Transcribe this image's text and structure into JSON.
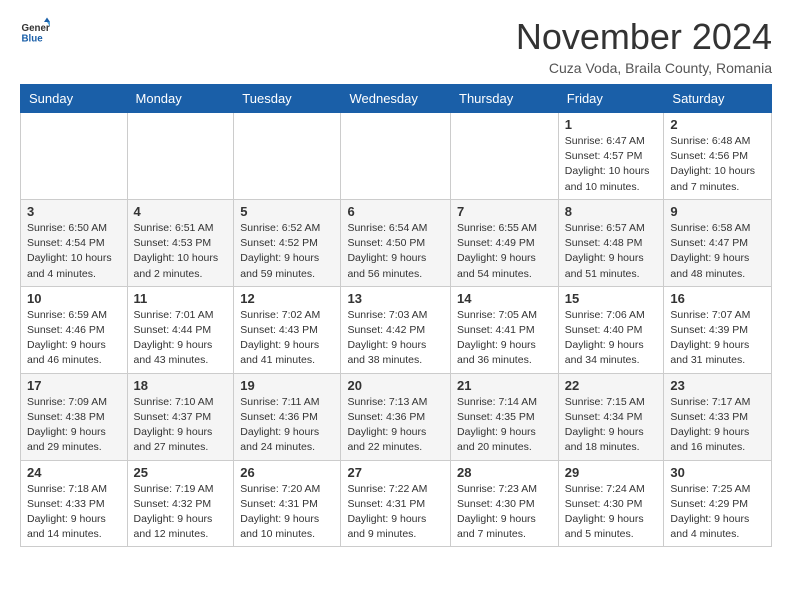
{
  "header": {
    "logo_line1": "General",
    "logo_line2": "Blue",
    "month_title": "November 2024",
    "location": "Cuza Voda, Braila County, Romania"
  },
  "weekdays": [
    "Sunday",
    "Monday",
    "Tuesday",
    "Wednesday",
    "Thursday",
    "Friday",
    "Saturday"
  ],
  "weeks": [
    [
      {
        "day": "",
        "info": ""
      },
      {
        "day": "",
        "info": ""
      },
      {
        "day": "",
        "info": ""
      },
      {
        "day": "",
        "info": ""
      },
      {
        "day": "",
        "info": ""
      },
      {
        "day": "1",
        "info": "Sunrise: 6:47 AM\nSunset: 4:57 PM\nDaylight: 10 hours and 10 minutes."
      },
      {
        "day": "2",
        "info": "Sunrise: 6:48 AM\nSunset: 4:56 PM\nDaylight: 10 hours and 7 minutes."
      }
    ],
    [
      {
        "day": "3",
        "info": "Sunrise: 6:50 AM\nSunset: 4:54 PM\nDaylight: 10 hours and 4 minutes."
      },
      {
        "day": "4",
        "info": "Sunrise: 6:51 AM\nSunset: 4:53 PM\nDaylight: 10 hours and 2 minutes."
      },
      {
        "day": "5",
        "info": "Sunrise: 6:52 AM\nSunset: 4:52 PM\nDaylight: 9 hours and 59 minutes."
      },
      {
        "day": "6",
        "info": "Sunrise: 6:54 AM\nSunset: 4:50 PM\nDaylight: 9 hours and 56 minutes."
      },
      {
        "day": "7",
        "info": "Sunrise: 6:55 AM\nSunset: 4:49 PM\nDaylight: 9 hours and 54 minutes."
      },
      {
        "day": "8",
        "info": "Sunrise: 6:57 AM\nSunset: 4:48 PM\nDaylight: 9 hours and 51 minutes."
      },
      {
        "day": "9",
        "info": "Sunrise: 6:58 AM\nSunset: 4:47 PM\nDaylight: 9 hours and 48 minutes."
      }
    ],
    [
      {
        "day": "10",
        "info": "Sunrise: 6:59 AM\nSunset: 4:46 PM\nDaylight: 9 hours and 46 minutes."
      },
      {
        "day": "11",
        "info": "Sunrise: 7:01 AM\nSunset: 4:44 PM\nDaylight: 9 hours and 43 minutes."
      },
      {
        "day": "12",
        "info": "Sunrise: 7:02 AM\nSunset: 4:43 PM\nDaylight: 9 hours and 41 minutes."
      },
      {
        "day": "13",
        "info": "Sunrise: 7:03 AM\nSunset: 4:42 PM\nDaylight: 9 hours and 38 minutes."
      },
      {
        "day": "14",
        "info": "Sunrise: 7:05 AM\nSunset: 4:41 PM\nDaylight: 9 hours and 36 minutes."
      },
      {
        "day": "15",
        "info": "Sunrise: 7:06 AM\nSunset: 4:40 PM\nDaylight: 9 hours and 34 minutes."
      },
      {
        "day": "16",
        "info": "Sunrise: 7:07 AM\nSunset: 4:39 PM\nDaylight: 9 hours and 31 minutes."
      }
    ],
    [
      {
        "day": "17",
        "info": "Sunrise: 7:09 AM\nSunset: 4:38 PM\nDaylight: 9 hours and 29 minutes."
      },
      {
        "day": "18",
        "info": "Sunrise: 7:10 AM\nSunset: 4:37 PM\nDaylight: 9 hours and 27 minutes."
      },
      {
        "day": "19",
        "info": "Sunrise: 7:11 AM\nSunset: 4:36 PM\nDaylight: 9 hours and 24 minutes."
      },
      {
        "day": "20",
        "info": "Sunrise: 7:13 AM\nSunset: 4:36 PM\nDaylight: 9 hours and 22 minutes."
      },
      {
        "day": "21",
        "info": "Sunrise: 7:14 AM\nSunset: 4:35 PM\nDaylight: 9 hours and 20 minutes."
      },
      {
        "day": "22",
        "info": "Sunrise: 7:15 AM\nSunset: 4:34 PM\nDaylight: 9 hours and 18 minutes."
      },
      {
        "day": "23",
        "info": "Sunrise: 7:17 AM\nSunset: 4:33 PM\nDaylight: 9 hours and 16 minutes."
      }
    ],
    [
      {
        "day": "24",
        "info": "Sunrise: 7:18 AM\nSunset: 4:33 PM\nDaylight: 9 hours and 14 minutes."
      },
      {
        "day": "25",
        "info": "Sunrise: 7:19 AM\nSunset: 4:32 PM\nDaylight: 9 hours and 12 minutes."
      },
      {
        "day": "26",
        "info": "Sunrise: 7:20 AM\nSunset: 4:31 PM\nDaylight: 9 hours and 10 minutes."
      },
      {
        "day": "27",
        "info": "Sunrise: 7:22 AM\nSunset: 4:31 PM\nDaylight: 9 hours and 9 minutes."
      },
      {
        "day": "28",
        "info": "Sunrise: 7:23 AM\nSunset: 4:30 PM\nDaylight: 9 hours and 7 minutes."
      },
      {
        "day": "29",
        "info": "Sunrise: 7:24 AM\nSunset: 4:30 PM\nDaylight: 9 hours and 5 minutes."
      },
      {
        "day": "30",
        "info": "Sunrise: 7:25 AM\nSunset: 4:29 PM\nDaylight: 9 hours and 4 minutes."
      }
    ]
  ]
}
